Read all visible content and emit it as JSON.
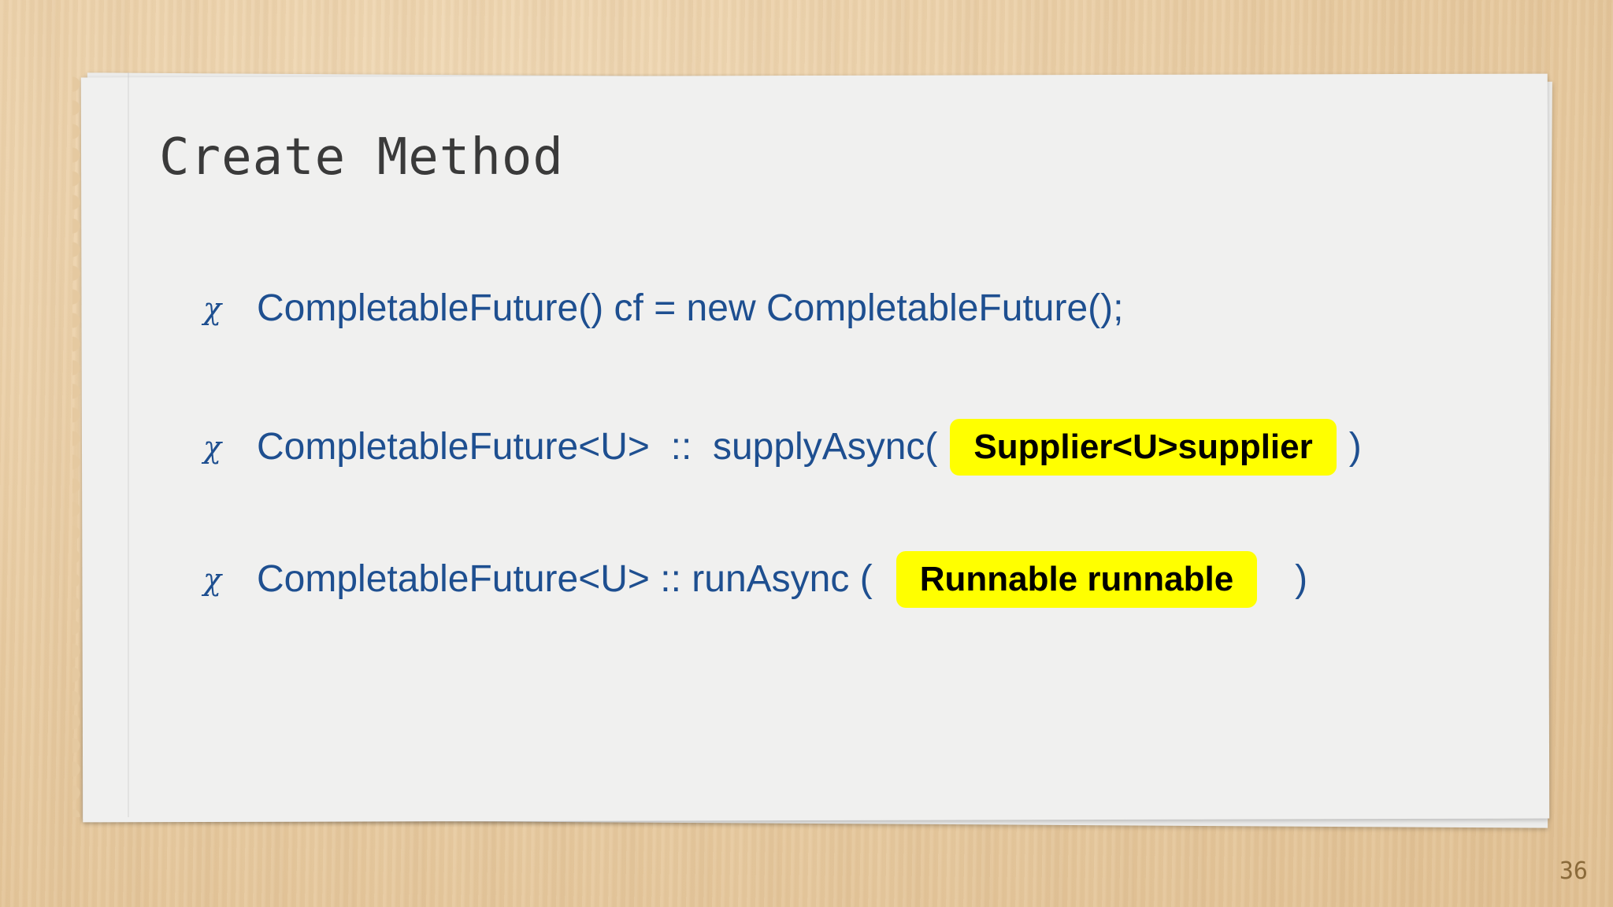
{
  "slide": {
    "title": "Create Method",
    "bullet_symbol": "χ",
    "items": [
      {
        "text": "CompletableFuture() cf = new CompletableFuture();"
      },
      {
        "prefix": "CompletableFuture<U>  ::  supplyAsync(",
        "highlight": "Supplier<U>supplier",
        "suffix": ")"
      },
      {
        "prefix": "CompletableFuture<U> :: runAsync (",
        "highlight": "Runnable runnable",
        "suffix": ")"
      }
    ],
    "page_number": "36"
  },
  "colors": {
    "text_blue": "#1e4f90",
    "highlight_yellow": "#ffff00",
    "title_gray": "#3a3a3a",
    "paper": "#f3f3f3",
    "background_wood": "#e9cda4"
  }
}
